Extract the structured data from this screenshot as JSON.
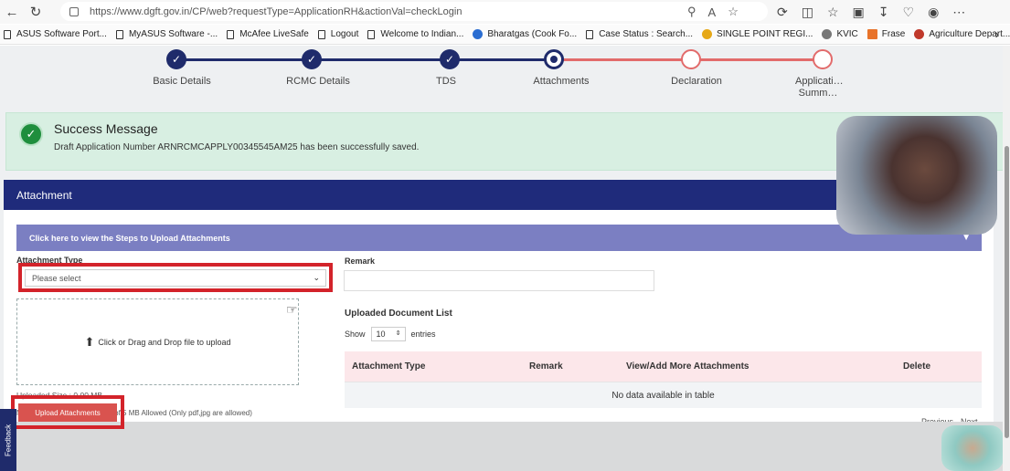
{
  "browser": {
    "url": "https://www.dgft.gov.in/CP/web?requestType=ApplicationRH&actionVal=checkLogin",
    "bookmarks": [
      {
        "label": "ASUS Software Port...",
        "icon": "doc"
      },
      {
        "label": "MyASUS Software -...",
        "icon": "doc"
      },
      {
        "label": "McAfee LiveSafe",
        "icon": "doc"
      },
      {
        "label": "Logout",
        "icon": "doc"
      },
      {
        "label": "Welcome to Indian...",
        "icon": "doc"
      },
      {
        "label": "Bharatgas (Cook Fo...",
        "icon": "globe"
      },
      {
        "label": "Case Status : Search...",
        "icon": "doc"
      },
      {
        "label": "SINGLE POINT REGI...",
        "icon": "plant"
      },
      {
        "label": "KVIC",
        "icon": "emblem"
      },
      {
        "label": "Frase",
        "icon": "flag"
      },
      {
        "label": "Agriculture Depart...",
        "icon": "emblem"
      }
    ]
  },
  "stepper": {
    "steps": [
      {
        "label": "Basic Details",
        "state": "done"
      },
      {
        "label": "RCMC Details",
        "state": "done"
      },
      {
        "label": "TDS",
        "state": "done"
      },
      {
        "label": "Attachments",
        "state": "current"
      },
      {
        "label": "Declaration",
        "state": "todo"
      },
      {
        "label": "Applicati… Summ…",
        "state": "todo"
      }
    ]
  },
  "success": {
    "title": "Success Message",
    "message": "Draft Application Number ARNRCMCAPPLY00345545AM25 has been successfully saved."
  },
  "attachment": {
    "header": "Attachment",
    "steps_link": "Click here to view the Steps to Upload Attachments",
    "type_label": "Attachment Type",
    "type_placeholder": "Please select",
    "remark_label": "Remark",
    "drop_text": "Click or Drag and Drop file to upload",
    "uploaded_size": "Uploaded Size : 0.00  MB",
    "note": "Note: Maximum 5 Attachment of 5 MB Allowed (Only pdf,jpg are allowed)",
    "upload_button": "Upload Attachments",
    "list_title": "Uploaded Document List",
    "show_label": "Show",
    "show_value": "10",
    "entries_label": "entries",
    "columns": [
      "Attachment Type",
      "Remark",
      "View/Add More Attachments",
      "Delete"
    ],
    "empty_text": "No data available in table",
    "prev": "Previous",
    "next": "Next"
  },
  "feedback_tab": "Feedback",
  "colors": {
    "primary": "#1f2b7b",
    "success_bg": "#d8efe2",
    "highlight": "#d3232a",
    "upload_btn": "#d9534f"
  }
}
